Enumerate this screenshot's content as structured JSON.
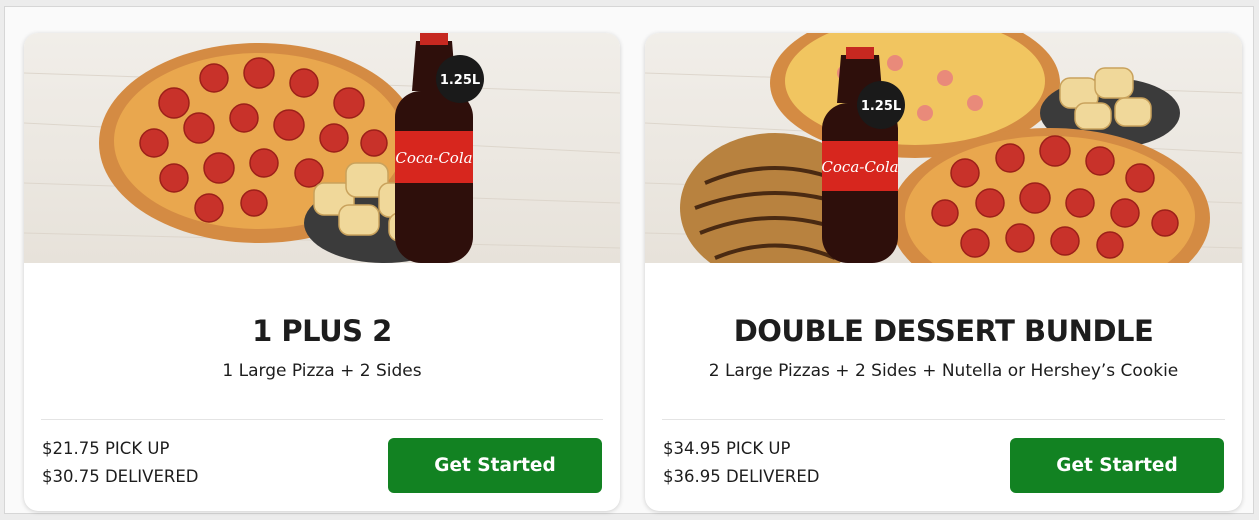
{
  "deals": [
    {
      "title": "1 PLUS 2",
      "description": "1 Large Pizza + 2 Sides",
      "pickup_price": "$21.75 PICK UP",
      "delivered_price": "$30.75 DELIVERED",
      "button_label": "Get Started",
      "bottle_label": "1.25L",
      "bottle_brand": "Coca-Cola"
    },
    {
      "title": "DOUBLE DESSERT BUNDLE",
      "description": "2 Large Pizzas + 2 Sides + Nutella or Hershey’s Cookie",
      "pickup_price": "$34.95 PICK UP",
      "delivered_price": "$36.95 DELIVERED",
      "button_label": "Get Started",
      "bottle_label": "1.25L",
      "bottle_brand": "Coca-Cola"
    }
  ],
  "colors": {
    "button_green": "#128222",
    "pizza_crust": "#d9944a",
    "pepperoni": "#c8322a",
    "cola": "#3a1410"
  }
}
